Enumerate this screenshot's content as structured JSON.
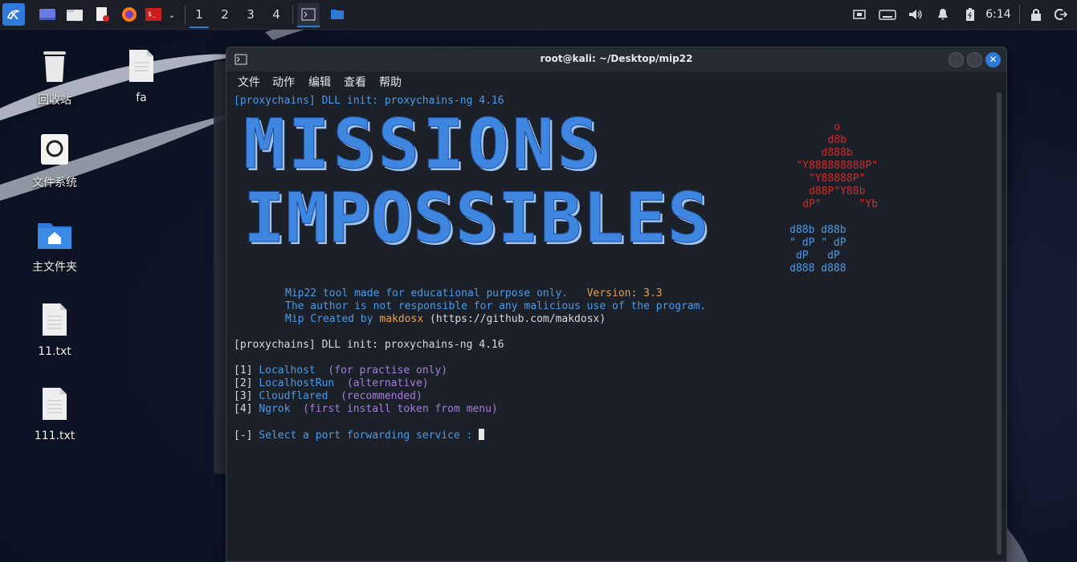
{
  "taskbar": {
    "workspaces": [
      "1",
      "2",
      "3",
      "4"
    ],
    "active_workspace": "1",
    "clock": "6:14",
    "accent": "#2f7ad8"
  },
  "desktop": {
    "icons": [
      {
        "label": "回收站",
        "icon": "trash-icon"
      },
      {
        "label": "fa",
        "icon": "file-icon"
      },
      {
        "label": "文件系统",
        "icon": "drive-icon"
      },
      {
        "label": "主文件夹",
        "icon": "home-folder-icon"
      },
      {
        "label": "11.txt",
        "icon": "text-file-icon"
      },
      {
        "label": "111.txt",
        "icon": "text-file-icon"
      }
    ]
  },
  "terminal": {
    "title": "root@kali: ~/Desktop/mip22",
    "menu": [
      "文件",
      "动作",
      "编辑",
      "查看",
      "帮助"
    ],
    "proxy_line_1": "[proxychains] DLL init: proxychains-ng 4.16",
    "banner_line_1": "MISSIONS",
    "banner_line_2": "IMPOSSIBLES",
    "ascii_red": [
      "          o",
      "         d8b",
      "        d888b",
      "    \"Y888888888P\"",
      "      \"Y88888P\"",
      "      d88P\"Y88b",
      "     dP\"      \"Yb"
    ],
    "ascii_blue": [
      "     d88b d88b",
      "     \" dP \" dP",
      "      dP   dP",
      "     d888 d888"
    ],
    "info_1": "Mip22 tool made for educational purpose only.",
    "version": "Version: 3.3",
    "info_2": "The author is not responsible for any malicious use of the program.",
    "info_3_prefix": "Mip Created by ",
    "info_3_author": "makdosx",
    "info_3_suffix": " (https://github.com/makdosx)",
    "proxy_line_2": "[proxychains] DLL init: proxychains-ng 4.16",
    "options": [
      {
        "num": "[1]",
        "name": "Localhost",
        "note": "(for practise only)"
      },
      {
        "num": "[2]",
        "name": "LocalhostRun",
        "note": "(alternative)"
      },
      {
        "num": "[3]",
        "name": "Cloudflared",
        "note": "(recommended)"
      },
      {
        "num": "[4]",
        "name": "Ngrok",
        "note": "(first install token from menu)"
      }
    ],
    "prompt_prefix": "[-]",
    "prompt_text": " Select a port forwarding service : "
  }
}
